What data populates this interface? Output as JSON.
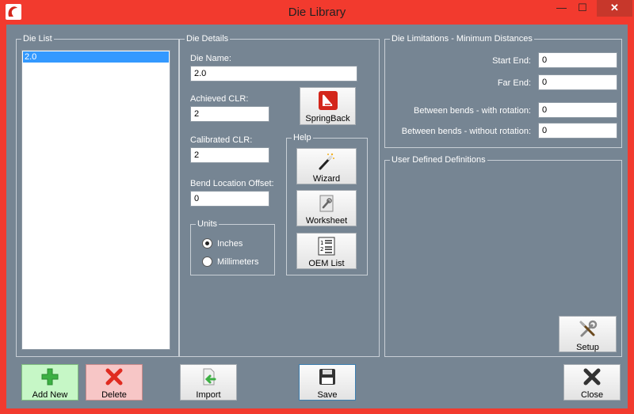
{
  "window": {
    "title": "Die Library",
    "minimize_glyph": "—",
    "maximize_glyph": "☐",
    "close_glyph": "✕"
  },
  "die_list": {
    "title": "Die List",
    "items": [
      "2.0"
    ],
    "selected": 0
  },
  "die_details": {
    "title": "Die Details",
    "die_name_label": "Die Name:",
    "die_name_value": "2.0",
    "achieved_clr_label": "Achieved CLR:",
    "achieved_clr_value": "2",
    "calibrated_clr_label": "Calibrated CLR:",
    "calibrated_clr_value": "2",
    "bend_location_offset_label": "Bend Location Offset:",
    "bend_location_offset_value": "0",
    "springback_label": "SpringBack",
    "units": {
      "title": "Units",
      "inches_label": "Inches",
      "millimeters_label": "Millimeters",
      "selected": "inches"
    },
    "help": {
      "title": "Help",
      "wizard_label": "Wizard",
      "worksheet_label": "Worksheet",
      "oem_list_label": "OEM List"
    }
  },
  "die_limitations": {
    "title": "Die Limitations - Minimum Distances",
    "start_end_label": "Start End:",
    "start_end_value": "0",
    "far_end_label": "Far End:",
    "far_end_value": "0",
    "between_with_rotation_label": "Between bends - with rotation:",
    "between_with_rotation_value": "0",
    "between_without_rotation_label": "Between bends - without rotation:",
    "between_without_rotation_value": "0"
  },
  "user_defined": {
    "title": "User Defined Definitions",
    "setup_label": "Setup"
  },
  "bottom_bar": {
    "add_new_label": "Add New",
    "delete_label": "Delete",
    "import_label": "Import",
    "save_label": "Save",
    "close_label": "Close"
  },
  "colors": {
    "client_bg": "#768593",
    "frame": "#f23a2e",
    "add_new_bg": "#c6f7c6",
    "delete_bg": "#f7c6c6",
    "selection": "#3399ff"
  }
}
